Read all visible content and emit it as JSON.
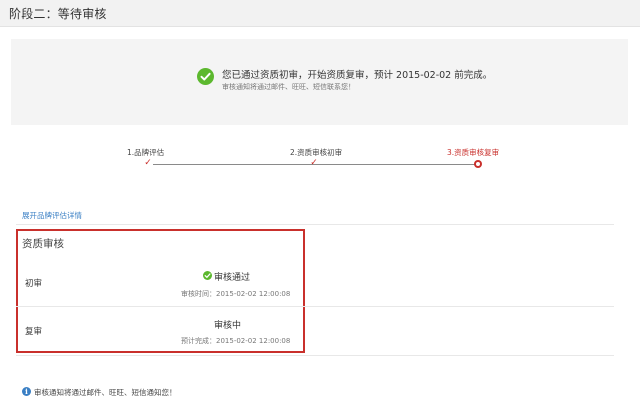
{
  "header": {
    "title": "阶段二：等待审核"
  },
  "notice": {
    "main_text": "您已通过资质初审，开始资质复审，预计 2015-02-02 前完成。",
    "sub_text": "审核通知将通过邮件、旺旺、短信联系您！"
  },
  "steps": [
    {
      "label": "1.品牌评估",
      "state": "done"
    },
    {
      "label": "2.资质审核初审",
      "state": "done"
    },
    {
      "label": "3.资质审核复审",
      "state": "current"
    }
  ],
  "expand_link": "展开品牌评估详情",
  "review": {
    "title": "资质审核",
    "rows": [
      {
        "label": "初审",
        "status": "审核通过",
        "time": "审核时间：2015-02-02 12:00:08"
      },
      {
        "label": "复审",
        "status": "审核中",
        "time": "预计完成：2015-02-02 12:00:08"
      }
    ]
  },
  "footer_note": "审核通知将通过邮件、旺旺、短信通知您！",
  "colors": {
    "accent_red": "#c9302c",
    "success_green": "#5cb82e",
    "link_blue": "#3a7fc4"
  },
  "icons": {
    "notice": "check-circle-icon",
    "pass": "check-circle-icon",
    "footer": "info-icon"
  }
}
